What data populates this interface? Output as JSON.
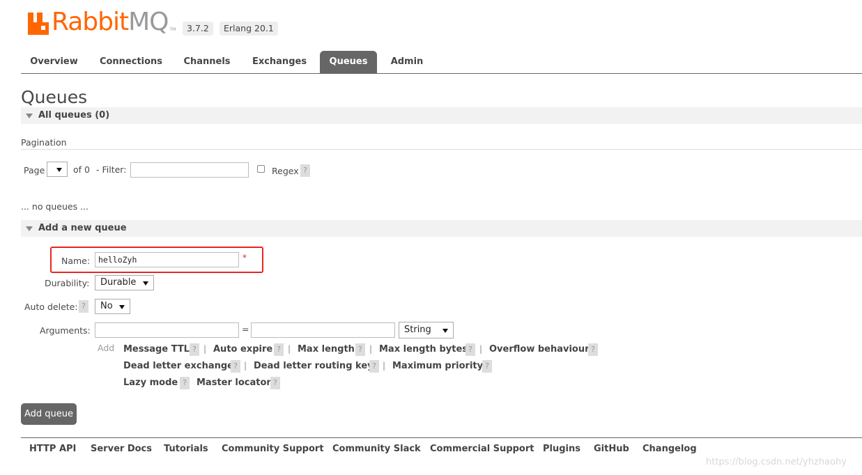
{
  "header": {
    "logo_main": "Rabbit",
    "logo_mq": "MQ",
    "logo_tm": "TM",
    "version": "3.7.2",
    "erlang": "Erlang 20.1"
  },
  "tabs": [
    "Overview",
    "Connections",
    "Channels",
    "Exchanges",
    "Queues",
    "Admin"
  ],
  "active_tab": "Queues",
  "page_title": "Queues",
  "all_queues": {
    "title": "All queues (0)",
    "pagination_label": "Pagination",
    "page_label": "Page",
    "page_value": "",
    "of_label": "of 0",
    "filter_label": "- Filter:",
    "filter_value": "",
    "regex_label": "Regex",
    "help": "?",
    "empty_text": "... no queues ..."
  },
  "add_queue": {
    "title": "Add a new queue",
    "name_label": "Name:",
    "name_value": "helloZyh",
    "required_mark": "*",
    "durability_label": "Durability:",
    "durability_value": "Durable",
    "auto_delete_label": "Auto delete:",
    "auto_delete_value": "No",
    "arguments_label": "Arguments:",
    "equals": "=",
    "arg_type": "String",
    "add_label": "Add",
    "arg_links": [
      [
        "Message TTL",
        "Auto expire",
        "Max length",
        "Max length bytes",
        "Overflow behaviour"
      ],
      [
        "Dead letter exchange",
        "Dead letter routing key",
        "Maximum priority"
      ],
      [
        "Lazy mode",
        "Master locator"
      ]
    ],
    "submit_label": "Add queue"
  },
  "footer": [
    "HTTP API",
    "Server Docs",
    "Tutorials",
    "Community Support",
    "Community Slack",
    "Commercial Support",
    "Plugins",
    "GitHub",
    "Changelog"
  ],
  "watermark": "https://blog.csdn.net/yhzhaohy",
  "colors": {
    "brand": "#ff6600",
    "tab_active": "#666666",
    "highlight": "#e8251f"
  }
}
